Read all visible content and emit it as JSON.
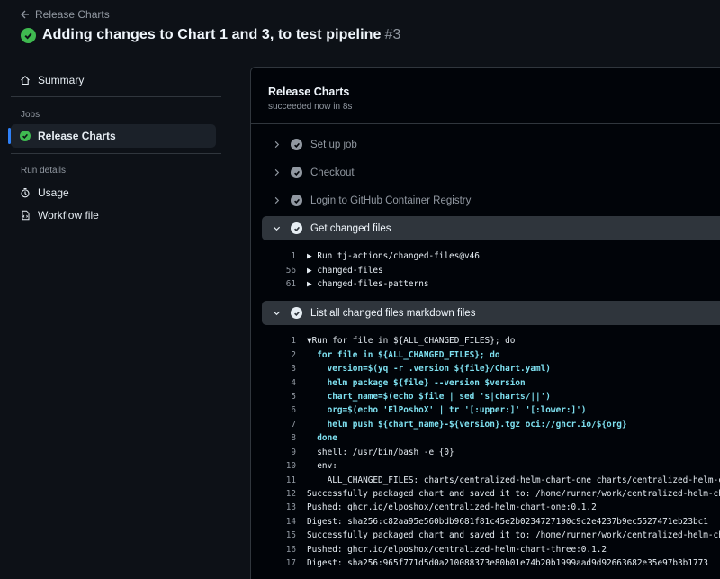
{
  "header": {
    "back_label": "Release Charts",
    "title": "Adding changes to Chart 1 and 3, to test pipeline",
    "run_number": "#3"
  },
  "sidebar": {
    "summary_label": "Summary",
    "jobs_heading": "Jobs",
    "jobs": [
      {
        "label": "Release Charts"
      }
    ],
    "run_details_heading": "Run details",
    "usage_label": "Usage",
    "workflow_file_label": "Workflow file"
  },
  "job": {
    "title": "Release Charts",
    "subtitle": "succeeded now in 8s",
    "steps": [
      {
        "label": "Set up job",
        "expanded": false
      },
      {
        "label": "Checkout",
        "expanded": false
      },
      {
        "label": "Login to GitHub Container Registry",
        "expanded": false
      },
      {
        "label": "Get changed files",
        "expanded": true
      },
      {
        "label": "List all changed files markdown files",
        "expanded": true
      }
    ],
    "get_changed_files_log": [
      {
        "n": "1",
        "text": "Run tj-actions/changed-files@v46",
        "tri": "▶"
      },
      {
        "n": "56",
        "text": "changed-files",
        "tri": "▶"
      },
      {
        "n": "61",
        "text": "changed-files-patterns",
        "tri": "▶"
      }
    ],
    "list_files_log": [
      {
        "n": "1",
        "text": "Run for file in ${ALL_CHANGED_FILES}; do",
        "tri": "▼"
      },
      {
        "n": "2",
        "text": "  for file in ${ALL_CHANGED_FILES}; do",
        "style": "cyan"
      },
      {
        "n": "3",
        "text": "    version=$(yq -r .version ${file}/Chart.yaml)",
        "style": "cyan"
      },
      {
        "n": "4",
        "text": "    helm package ${file} --version $version",
        "style": "cyan"
      },
      {
        "n": "5",
        "text": "    chart_name=$(echo $file | sed 's|charts/||')",
        "style": "cyan"
      },
      {
        "n": "6",
        "text": "    org=$(echo 'ElPoshoX' | tr '[:upper:]' '[:lower:]')",
        "style": "cyan"
      },
      {
        "n": "7",
        "text": "    helm push ${chart_name}-${version}.tgz oci://ghcr.io/${org}",
        "style": "cyan"
      },
      {
        "n": "8",
        "text": "  done",
        "style": "cyan"
      },
      {
        "n": "9",
        "text": "  shell: /usr/bin/bash -e {0}"
      },
      {
        "n": "10",
        "text": "  env:"
      },
      {
        "n": "11",
        "text": "    ALL_CHANGED_FILES: charts/centralized-helm-chart-one charts/centralized-helm-c"
      },
      {
        "n": "12",
        "text": "Successfully packaged chart and saved it to: /home/runner/work/centralized-helm-ch"
      },
      {
        "n": "13",
        "text": "Pushed: ghcr.io/elposhox/centralized-helm-chart-one:0.1.2"
      },
      {
        "n": "14",
        "text": "Digest: sha256:c82aa95e560bdb9681f81c45e2b0234727190c9c2e4237b9ec5527471eb23bc1"
      },
      {
        "n": "15",
        "text": "Successfully packaged chart and saved it to: /home/runner/work/centralized-helm-ch"
      },
      {
        "n": "16",
        "text": "Pushed: ghcr.io/elposhox/centralized-helm-chart-three:0.1.2"
      },
      {
        "n": "17",
        "text": "Digest: sha256:965f771d5d0a210088373e80b01e74b20b1999aad9d92663682e35e97b3b1773"
      }
    ]
  },
  "colors": {
    "success": "#3fb950",
    "accent": "#2f81f7",
    "background": "#0d1117"
  }
}
